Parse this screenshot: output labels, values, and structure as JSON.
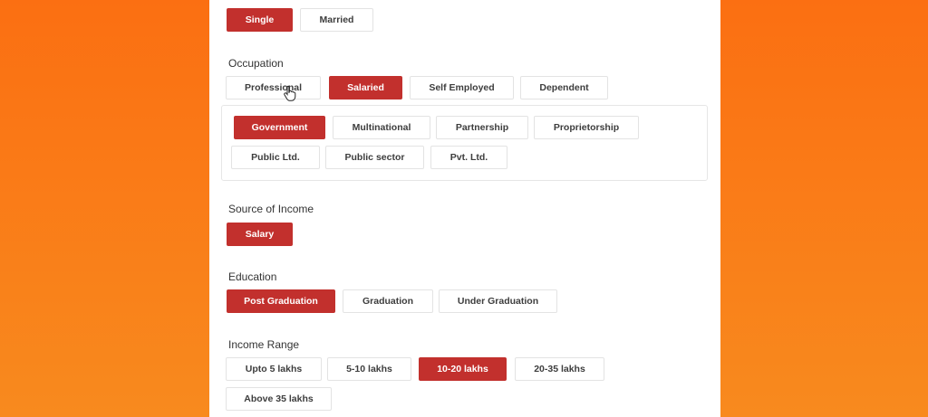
{
  "marital_status": {
    "options": [
      {
        "label": "Single",
        "selected": true
      },
      {
        "label": "Married",
        "selected": false
      }
    ]
  },
  "occupation": {
    "label": "Occupation",
    "options": [
      {
        "label": "Professional",
        "selected": false
      },
      {
        "label": "Salaried",
        "selected": true
      },
      {
        "label": "Self Employed",
        "selected": false
      },
      {
        "label": "Dependent",
        "selected": false
      }
    ],
    "sub_options": [
      {
        "label": "Government",
        "selected": true
      },
      {
        "label": "Multinational",
        "selected": false
      },
      {
        "label": "Partnership",
        "selected": false
      },
      {
        "label": "Proprietorship",
        "selected": false
      },
      {
        "label": "Public Ltd.",
        "selected": false
      },
      {
        "label": "Public sector",
        "selected": false
      },
      {
        "label": "Pvt. Ltd.",
        "selected": false
      }
    ]
  },
  "source_of_income": {
    "label": "Source of Income",
    "options": [
      {
        "label": "Salary",
        "selected": true
      }
    ]
  },
  "education": {
    "label": "Education",
    "options": [
      {
        "label": "Post Graduation",
        "selected": true
      },
      {
        "label": "Graduation",
        "selected": false
      },
      {
        "label": "Under Graduation",
        "selected": false
      }
    ]
  },
  "income_range": {
    "label": "Income Range",
    "options": [
      {
        "label": "Upto 5 lakhs",
        "selected": false
      },
      {
        "label": "5-10 lakhs",
        "selected": false
      },
      {
        "label": "10-20 lakhs",
        "selected": true
      },
      {
        "label": "20-35 lakhs",
        "selected": false
      },
      {
        "label": "Above 35 lakhs",
        "selected": false
      }
    ]
  },
  "theme": {
    "selected_color": "#c2302d",
    "background_orange": "#fb6f12"
  }
}
